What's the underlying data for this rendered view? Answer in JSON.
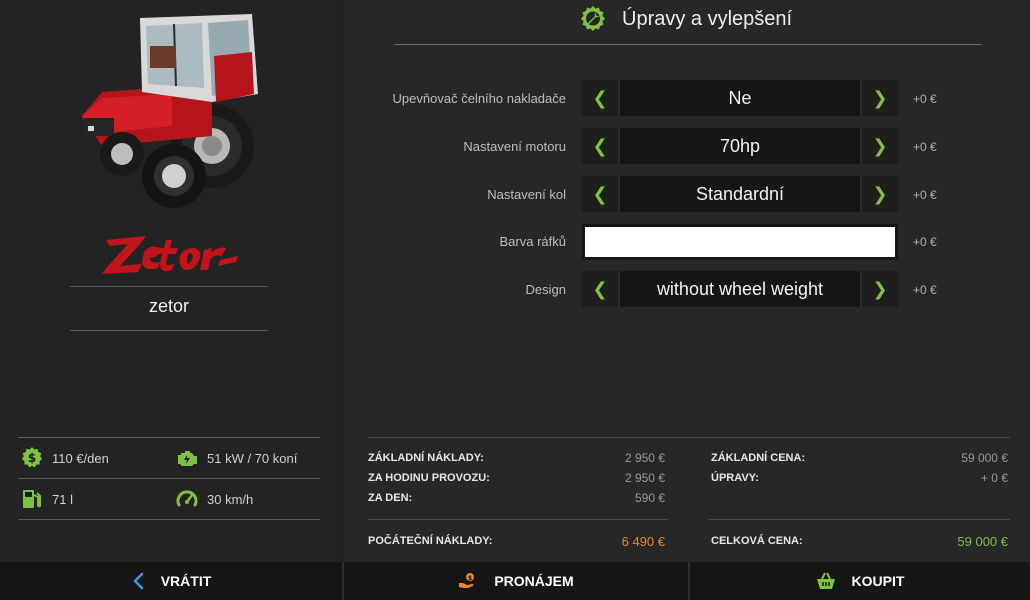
{
  "vehicle": {
    "brand": "Zetor",
    "model_name": "zetor"
  },
  "stats": {
    "cost_per_day": "110 €/den",
    "power": "51 kW / 70 koní",
    "fuel_capacity": "71 l",
    "max_speed": "30 km/h"
  },
  "section": {
    "title": "Úpravy a vylepšení"
  },
  "options": [
    {
      "label": "Upevňovač čelního nakladače",
      "value": "Ne",
      "price": "+0 €"
    },
    {
      "label": "Nastavení motoru",
      "value": "70hp",
      "price": "+0 €"
    },
    {
      "label": "Nastavení kol",
      "value": "Standardní",
      "price": "+0 €"
    },
    {
      "label": "Barva ráfků",
      "color": "#ffffff",
      "price": "+0 €"
    },
    {
      "label": "Design",
      "value": "without wheel weight",
      "price": "+0 €"
    }
  ],
  "costs": {
    "base_costs_label": "ZÁKLADNÍ NÁKLADY:",
    "base_costs_value": "2 950 €",
    "per_hour_label": "ZA HODINU PROVOZU:",
    "per_hour_value": "2 950 €",
    "per_day_label": "ZA DEN:",
    "per_day_value": "590 €",
    "initial_label": "POČÁTEČNÍ NÁKLADY:",
    "initial_value": "6 490 €",
    "base_price_label": "ZÁKLADNÍ CENA:",
    "base_price_value": "59 000 €",
    "mods_label": "ÚPRAVY:",
    "mods_value": "+ 0 €",
    "total_label": "CELKOVÁ CENA:",
    "total_value": "59 000 €"
  },
  "actions": {
    "back": "VRÁTIT",
    "lease": "PRONÁJEM",
    "buy": "KOUPIT"
  },
  "colors": {
    "accent_green": "#7dc242",
    "initial_cost_orange": "#e8872a",
    "total_price_green": "#7dc242",
    "back_icon_blue": "#3b9be0",
    "lease_icon_orange": "#e8872a"
  }
}
